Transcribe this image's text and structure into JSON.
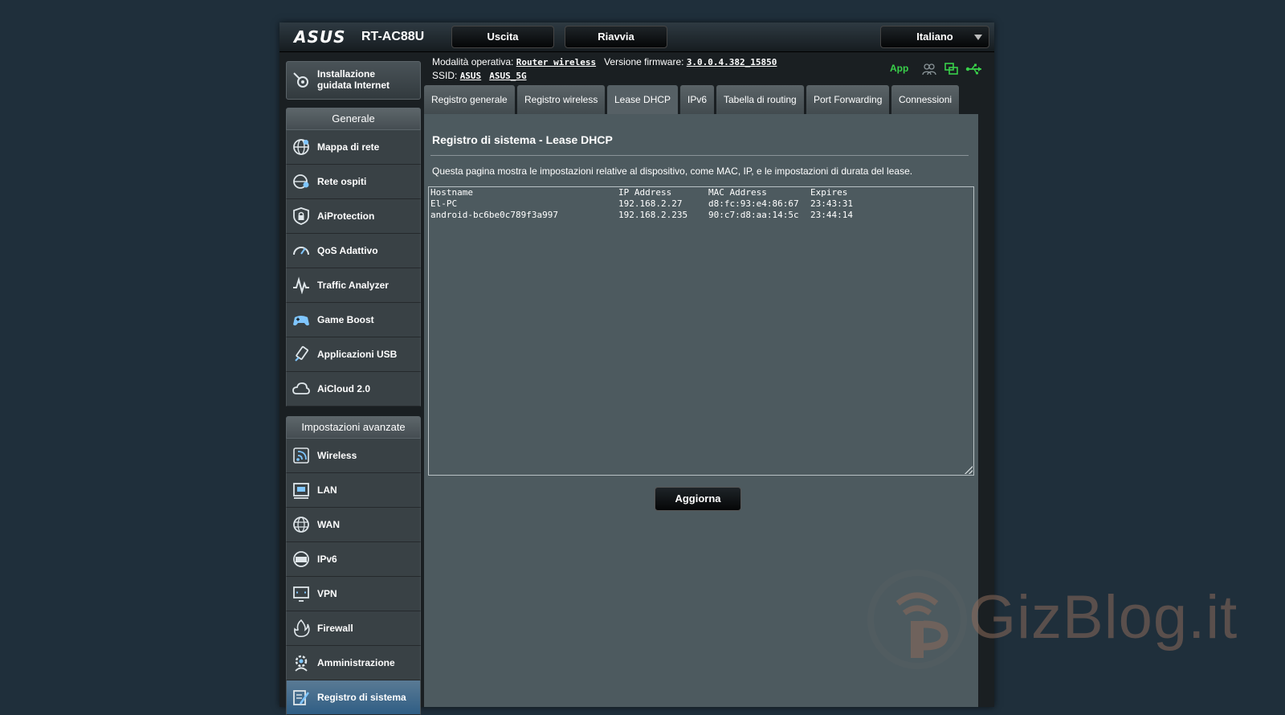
{
  "header": {
    "brand": "ASUS",
    "model": "RT-AC88U",
    "logout_label": "Uscita",
    "reboot_label": "Riavvia",
    "language": "Italiano"
  },
  "info": {
    "mode_label": "Modalità operativa:",
    "mode_value": "Router wireless",
    "firmware_label": "Versione firmware:",
    "firmware_value": "3.0.0.4.382_15850",
    "ssid_label": "SSID:",
    "ssid_values": [
      "ASUS",
      "ASUS_5G"
    ],
    "app_label": "App"
  },
  "sidebar": {
    "qis_label_line1": "Installazione",
    "qis_label_line2": "guidata Internet",
    "general_title": "Generale",
    "general_items": [
      {
        "label": "Mappa di rete",
        "icon": "network-map-icon"
      },
      {
        "label": "Rete ospiti",
        "icon": "guest-network-icon"
      },
      {
        "label": "AiProtection",
        "icon": "shield-lock-icon"
      },
      {
        "label": "QoS Adattivo",
        "icon": "speedometer-icon"
      },
      {
        "label": "Traffic Analyzer",
        "icon": "traffic-wave-icon"
      },
      {
        "label": "Game Boost",
        "icon": "gamepad-icon"
      },
      {
        "label": "Applicazioni USB",
        "icon": "usb-app-icon"
      },
      {
        "label": "AiCloud 2.0",
        "icon": "cloud-icon"
      }
    ],
    "advanced_title": "Impostazioni avanzate",
    "advanced_items": [
      {
        "label": "Wireless",
        "icon": "wireless-icon"
      },
      {
        "label": "LAN",
        "icon": "lan-icon"
      },
      {
        "label": "WAN",
        "icon": "globe-icon"
      },
      {
        "label": "IPv6",
        "icon": "ipv6-globe-icon"
      },
      {
        "label": "VPN",
        "icon": "vpn-monitor-icon"
      },
      {
        "label": "Firewall",
        "icon": "fire-icon"
      },
      {
        "label": "Amministrazione",
        "icon": "gear-person-icon"
      },
      {
        "label": "Registro di sistema",
        "icon": "log-pencil-icon"
      }
    ]
  },
  "tabs": [
    {
      "label": "Registro generale"
    },
    {
      "label": "Registro wireless"
    },
    {
      "label": "Lease DHCP"
    },
    {
      "label": "IPv6"
    },
    {
      "label": "Tabella di routing"
    },
    {
      "label": "Port Forwarding"
    },
    {
      "label": "Connessioni"
    }
  ],
  "content": {
    "title": "Registro di sistema - Lease DHCP",
    "description": "Questa pagina mostra le impostazioni relative al dispositivo, come MAC, IP, e le impostazioni di durata del lease.",
    "columns": [
      "Hostname",
      "IP Address",
      "MAC Address",
      "Expires"
    ],
    "rows": [
      [
        "El-PC",
        "192.168.2.27",
        "d8:fc:93:e4:86:67",
        "23:43:31"
      ],
      [
        "android-bc6be0c789f3a997",
        "192.168.2.235",
        "90:c7:d8:aa:14:5c",
        "23:44:14"
      ]
    ],
    "refresh_label": "Aggiorna"
  },
  "watermark": {
    "text": "GizBlog.it"
  },
  "colors": {
    "accent_green": "#39d04a",
    "active_menu": "#2f5e85"
  }
}
